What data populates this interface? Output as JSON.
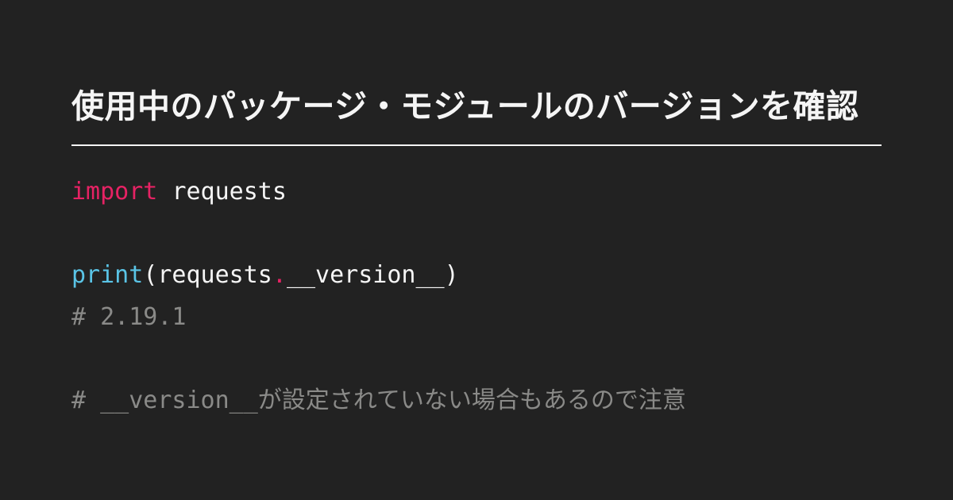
{
  "title": "使用中のパッケージ・モジュールのバージョンを確認",
  "code": {
    "line1": {
      "keyword": "import",
      "module": "requests"
    },
    "line3": {
      "func": "print",
      "open": "(",
      "obj": "requests",
      "dot": ".",
      "attr": "__version__",
      "close": ")"
    },
    "line4": "# 2.19.1",
    "line6": "# __version__が設定されていない場合もあるので注意"
  }
}
